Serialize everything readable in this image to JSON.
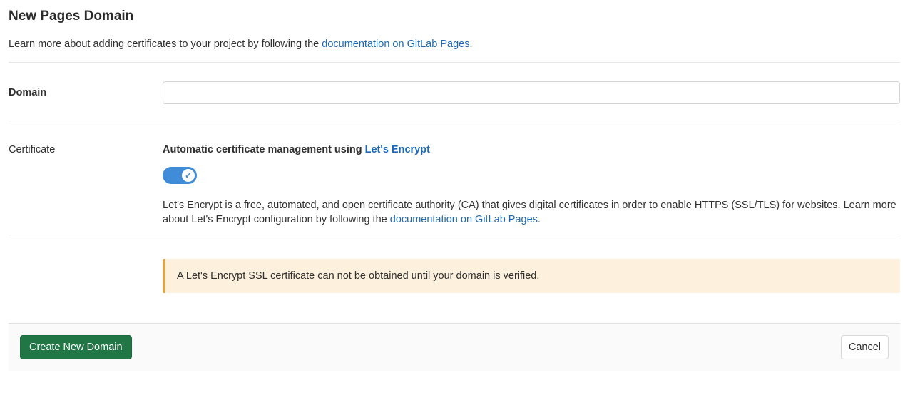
{
  "page": {
    "title": "New Pages Domain",
    "intro": {
      "text_before": "Learn more about adding certificates to your project by following the ",
      "link_text": "documentation on GitLab Pages",
      "text_after": "."
    }
  },
  "form": {
    "domain": {
      "label": "Domain",
      "value": "",
      "placeholder": ""
    },
    "certificate": {
      "label": "Certificate",
      "title_before": "Automatic certificate management using ",
      "title_link": "Let's Encrypt",
      "toggle": {
        "state": "true",
        "check_glyph": "✓"
      },
      "description_before": "Let's Encrypt is a free, automated, and open certificate authority (CA) that gives digital certificates in order to enable HTTPS (SSL/TLS) for websites. Learn more about Let's Encrypt configuration by following the ",
      "description_link": "documentation on GitLab Pages",
      "description_after": "."
    },
    "alert": {
      "text": "A Let's Encrypt SSL certificate can not be obtained until your domain is verified."
    }
  },
  "footer": {
    "submit_label": "Create New Domain",
    "cancel_label": "Cancel"
  },
  "colors": {
    "link": "#1b69b6",
    "toggle_on": "#418cd8",
    "submit_bg": "#217645",
    "alert_bg": "#fdf1dd",
    "alert_border": "#d9a54e"
  }
}
